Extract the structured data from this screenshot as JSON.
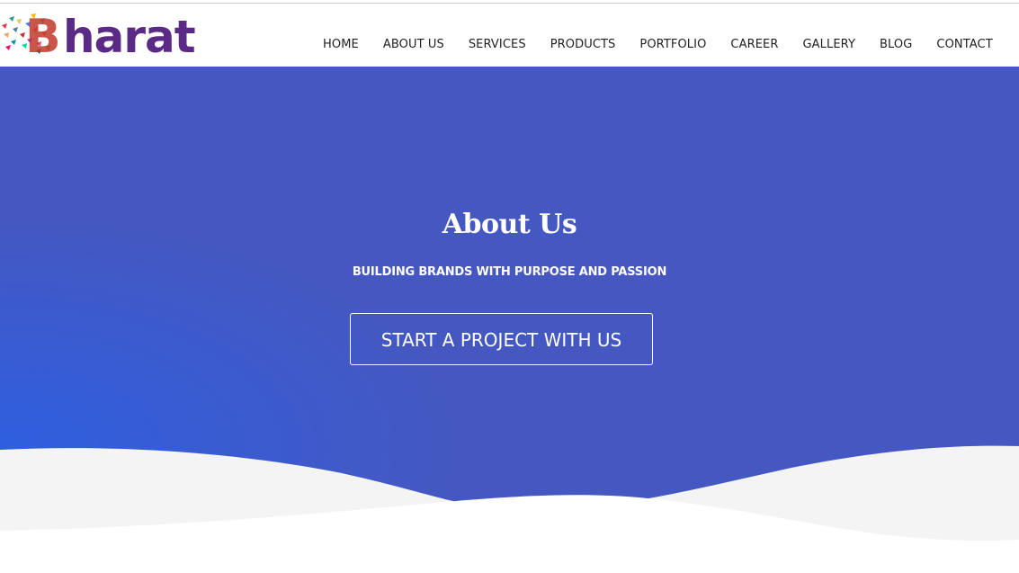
{
  "logo": {
    "text": "Bharat",
    "colors": {
      "wordmark": "#5b2a86"
    }
  },
  "nav": {
    "items": [
      {
        "label": "HOME"
      },
      {
        "label": "ABOUT US"
      },
      {
        "label": "SERVICES"
      },
      {
        "label": "PRODUCTS"
      },
      {
        "label": "PORTFOLIO"
      },
      {
        "label": "CAREER"
      },
      {
        "label": "GALLERY"
      },
      {
        "label": "BLOG"
      },
      {
        "label": "CONTACT"
      }
    ]
  },
  "hero": {
    "title": "About Us",
    "subtitle": "BUILDING BRANDS WITH PURPOSE AND PASSION",
    "cta_label": "START A PROJECT WITH US",
    "colors": {
      "background": "#4558c1",
      "gradient_left": "#2f5fe0",
      "wave_light": "#f4f4f4",
      "wave_white": "#ffffff"
    }
  }
}
